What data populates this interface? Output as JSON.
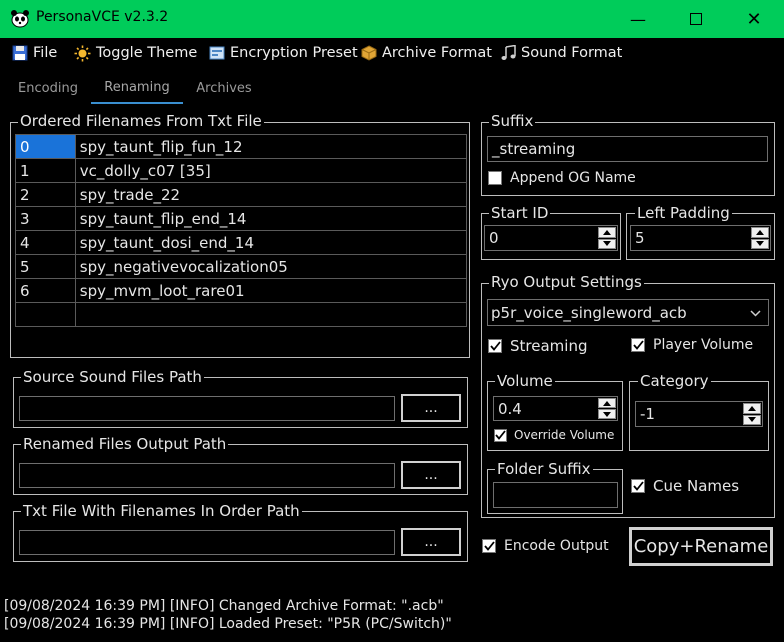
{
  "window": {
    "title": "PersonaVCE v2.3.2",
    "title_bar_color": "#00cc5a"
  },
  "menu": {
    "file": "File",
    "toggle_theme": "Toggle Theme",
    "encryption_preset": "Encryption Preset",
    "archive_format": "Archive Format",
    "sound_format": "Sound Format"
  },
  "tabs": {
    "encoding": "Encoding",
    "renaming": "Renaming",
    "archives": "Archives",
    "active": "Renaming"
  },
  "ordered_filenames": {
    "label": "Ordered Filenames From Txt File",
    "rows": [
      {
        "index": "0",
        "name": "spy_taunt_flip_fun_12"
      },
      {
        "index": "1",
        "name": "vc_dolly_c07 [35]"
      },
      {
        "index": "2",
        "name": "spy_trade_22"
      },
      {
        "index": "3",
        "name": "spy_taunt_flip_end_14"
      },
      {
        "index": "4",
        "name": "spy_taunt_dosi_end_14"
      },
      {
        "index": "5",
        "name": "spy_negativevocalization05"
      },
      {
        "index": "6",
        "name": "spy_mvm_loot_rare01"
      },
      {
        "index": "",
        "name": ""
      }
    ],
    "selected_index": "0"
  },
  "source_sound_path": {
    "label": "Source Sound Files Path",
    "value": "",
    "button": "..."
  },
  "renamed_output_path": {
    "label": "Renamed Files Output Path",
    "value": "",
    "button": "..."
  },
  "txt_file_path": {
    "label": "Txt File With Filenames In Order Path",
    "value": "",
    "button": "..."
  },
  "suffix": {
    "label": "Suffix",
    "value": "_streaming",
    "append_og_name": {
      "label": "Append OG Name",
      "checked": false
    }
  },
  "start_id": {
    "label": "Start ID",
    "value": "0"
  },
  "left_padding": {
    "label": "Left Padding",
    "value": "5"
  },
  "ryo": {
    "label": "Ryo Output Settings",
    "preset": "p5r_voice_singleword_acb",
    "streaming": {
      "label": "Streaming",
      "checked": true
    },
    "player_volume": {
      "label": "Player Volume",
      "checked": true
    },
    "volume": {
      "label": "Volume",
      "value": "0.4",
      "override": {
        "label": "Override Volume",
        "checked": true
      }
    },
    "category": {
      "label": "Category",
      "value": "-1"
    },
    "folder_suffix": {
      "label": "Folder Suffix",
      "value": ""
    },
    "cue_names": {
      "label": "Cue Names",
      "checked": true
    }
  },
  "encode_output": {
    "label": "Encode Output",
    "checked": true
  },
  "copy_rename_button": "Copy+Rename",
  "log": [
    "[09/08/2024 16:39 PM] [INFO] Changed Archive Format: \".acb\"",
    "[09/08/2024 16:39 PM] [INFO] Loaded Preset: \"P5R (PC/Switch)\""
  ],
  "colors": {
    "accent": "#00cc5a",
    "selection": "#1a73d9",
    "tab_indicator": "#3a8fd0"
  }
}
